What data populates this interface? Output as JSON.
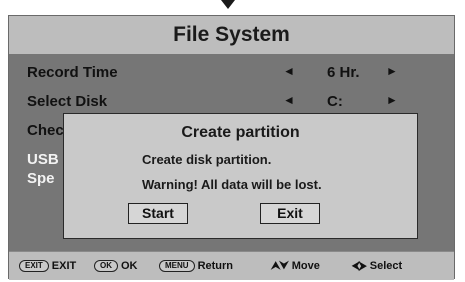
{
  "header": {
    "title": "File System"
  },
  "menu": {
    "rows": [
      {
        "label": "Record Time",
        "value": "6 Hr.",
        "left": "◄",
        "right": "►"
      },
      {
        "label": "Select Disk",
        "value": "C:",
        "left": "◄",
        "right": "►"
      },
      {
        "label": "Chec"
      },
      {
        "label": "USB"
      },
      {
        "label": "Spe"
      }
    ]
  },
  "dialog": {
    "title": "Create partition",
    "line1": "Create disk partition.",
    "line2": "Warning! All data will be lost.",
    "start_label": "Start",
    "exit_label": "Exit"
  },
  "footer": {
    "exit_key": "EXIT",
    "exit_label": "EXIT",
    "ok_key": "OK",
    "ok_label": "OK",
    "menu_key": "MENU",
    "menu_label": "Return",
    "move_icon": "⮝⮟",
    "move_label": "Move",
    "select_icon": "⮜⮞",
    "select_label": "Select"
  }
}
